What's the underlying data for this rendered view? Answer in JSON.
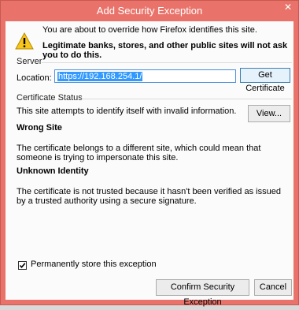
{
  "window": {
    "title": "Add Security Exception",
    "close_glyph": "✕"
  },
  "message": {
    "line1": "You are about to override how Firefox identifies this site.",
    "line2": "Legitimate banks, stores, and other public sites will not ask you to do this."
  },
  "server": {
    "group_label": "Server",
    "location_label": "Location:",
    "location_value": "https://192.168.254.1/",
    "get_certificate_label": "Get Certificate"
  },
  "status": {
    "group_label": "Certificate Status",
    "intro": "This site attempts to identify itself with invalid information.",
    "view_label": "View...",
    "wrong_site_heading": "Wrong Site",
    "wrong_site_text": "The certificate belongs to a different site, which could mean that someone is trying to impersonate this site.",
    "unknown_identity_heading": "Unknown Identity",
    "unknown_identity_text": "The certificate is not trusted because it hasn't been verified as issued by a trusted authority using a secure signature."
  },
  "permanent": {
    "label": "Permanently store this exception",
    "checked": true
  },
  "buttons": {
    "confirm_label": "Confirm Security Exception",
    "cancel_label": "Cancel"
  },
  "icons": {
    "warning": "warning-icon",
    "close": "close-icon",
    "check": "checkmark-icon"
  },
  "colors": {
    "titlebar": "#e9736a",
    "selection": "#3399ff",
    "warning_fill": "#f7c51c"
  }
}
